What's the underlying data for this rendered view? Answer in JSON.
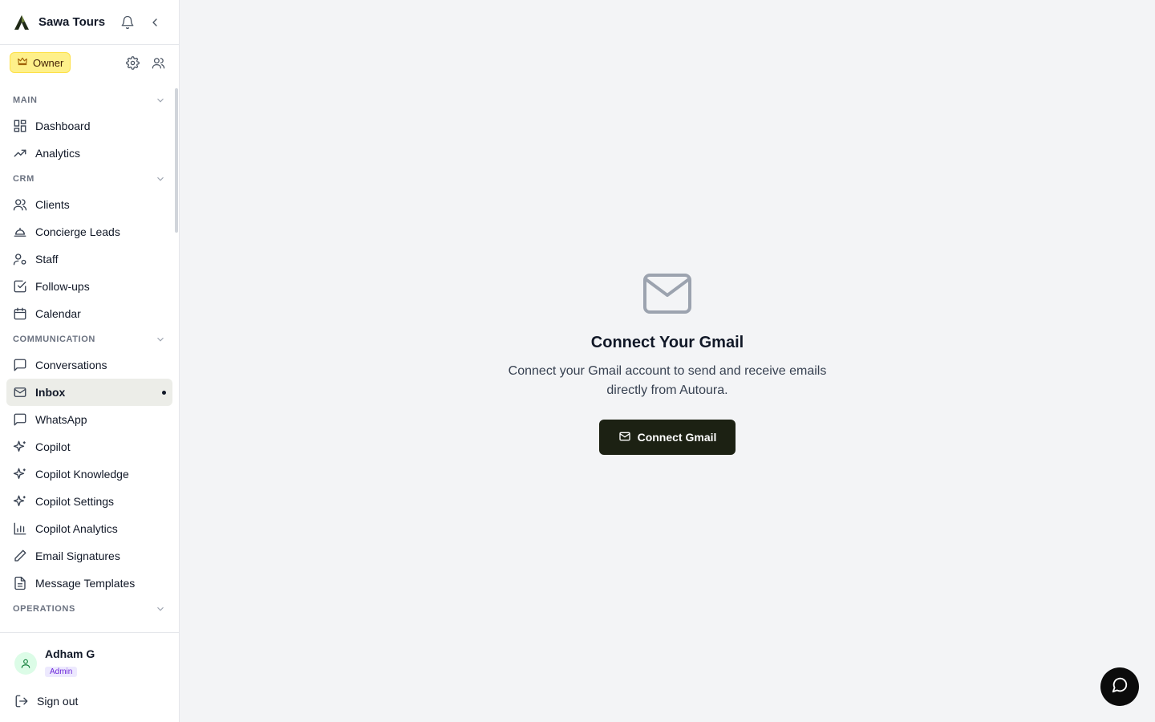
{
  "brand": {
    "name": "Sawa Tours",
    "logo_icon": "leaf-a-logo"
  },
  "header": {
    "notifications_icon": "bell-icon",
    "collapse_icon": "chevron-left-icon"
  },
  "role": {
    "label": "Owner",
    "icon": "crown-icon",
    "color": "#fef08a"
  },
  "sections": {
    "main": "MAIN",
    "crm": "CRM",
    "communication": "COMMUNICATION",
    "operations": "OPERATIONS"
  },
  "nav": {
    "dashboard": "Dashboard",
    "analytics": "Analytics",
    "clients": "Clients",
    "concierge_leads": "Concierge Leads",
    "staff": "Staff",
    "follow_ups": "Follow-ups",
    "calendar": "Calendar",
    "conversations": "Conversations",
    "inbox": "Inbox",
    "whatsapp": "WhatsApp",
    "copilot": "Copilot",
    "copilot_knowledge": "Copilot Knowledge",
    "copilot_settings": "Copilot Settings",
    "copilot_analytics": "Copilot Analytics",
    "email_signatures": "Email Signatures",
    "message_templates": "Message Templates"
  },
  "active_item": "Inbox",
  "user": {
    "name": "Adham G",
    "role_badge": "Admin"
  },
  "signout_label": "Sign out",
  "empty_state": {
    "icon": "mail-icon",
    "title": "Connect Your Gmail",
    "description": "Connect your Gmail account to send and receive emails directly from Autoura.",
    "button_label": "Connect Gmail"
  },
  "colors": {
    "accent_dark": "#1c2113",
    "active_bg": "#ecede8",
    "page_bg": "#f3f4f6"
  }
}
